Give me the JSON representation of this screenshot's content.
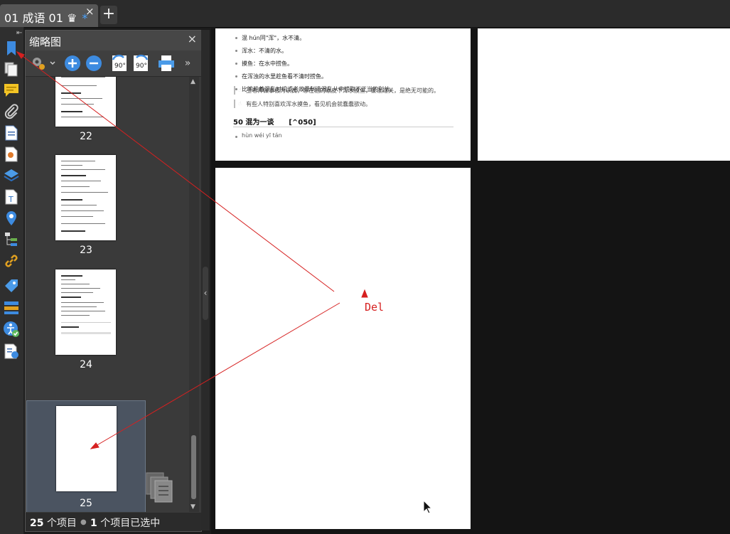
{
  "tabbar": {
    "tab_title": "01 成语 01 ♛",
    "tab_modified": "*",
    "close_glyph": "×",
    "add_glyph": "+"
  },
  "rail": {
    "collapse_glyph": "⇤",
    "icons": [
      "bookmark-icon",
      "pages-icon",
      "comment-icon",
      "attachment-icon",
      "document-properties-icon",
      "certificate-icon",
      "layers-icon",
      "form-fields-icon",
      "destinations-icon",
      "structure-tree-icon",
      "links-icon",
      "tags-icon",
      "content-order-icon",
      "accessibility-check-icon",
      "reading-order-icon"
    ]
  },
  "panel": {
    "title": "缩略图",
    "close_glyph": "×",
    "toolbar": {
      "rotate_ccw_label": "90°",
      "rotate_cw_label": "90°",
      "more_glyph": "»"
    },
    "thumbnails": [
      {
        "label": "22",
        "selected": false
      },
      {
        "label": "23",
        "selected": false
      },
      {
        "label": "24",
        "selected": false
      },
      {
        "label": "25",
        "selected": true
      }
    ],
    "status": {
      "count": "25",
      "count_suffix": "个项目",
      "sep": "●",
      "selected_count": "1",
      "selected_suffix": "个项目已选中"
    }
  },
  "document": {
    "lines": [
      "混 hún同\"浑\"，水不清。",
      "浑水：不清的水。",
      "摸鱼：在水中捞鱼。",
      "在浑浊的水里趁鱼看不清时捞鱼。",
      "比喻趁着混乱时机或者故意制造混乱从中捞取不正当的利益。"
    ],
    "quotes": [
      "王老师做事极为认真，想在他的眼皮下浑水摸鱼，蒙混过关，是绝无可能的。",
      "有些人特别喜欢浑水摸鱼，看见机会就蠢蠢欲动。"
    ],
    "heading": "50 混为一谈",
    "heading_tag": "[^050]",
    "pinyin": "hùn wéi yī tán"
  },
  "annotation": {
    "label": "Del",
    "color": "#d62020"
  }
}
